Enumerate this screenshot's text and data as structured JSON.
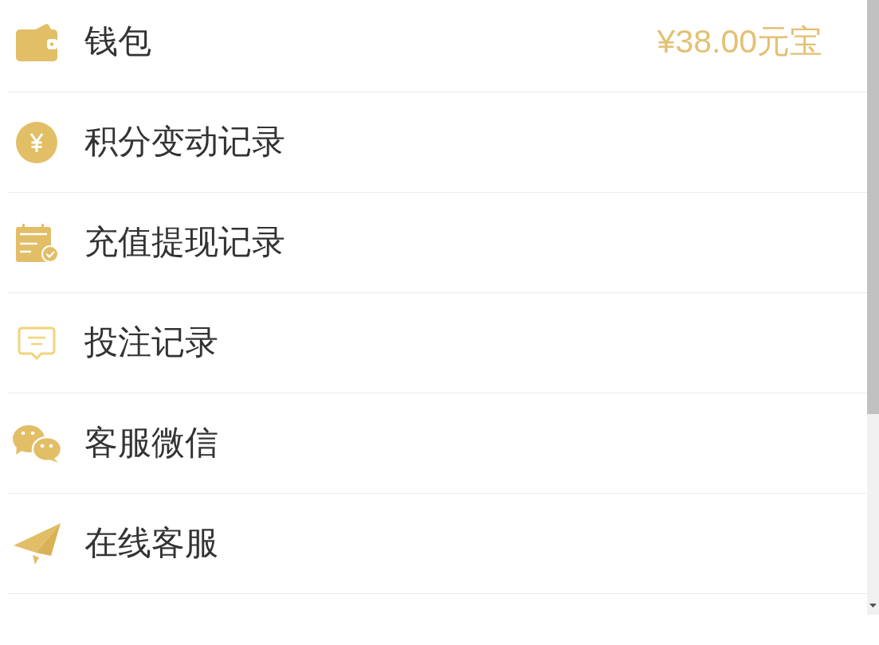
{
  "menu": [
    {
      "label": "钱包",
      "value": "¥38.00元宝"
    },
    {
      "label": "积分变动记录"
    },
    {
      "label": "充值提现记录"
    },
    {
      "label": "投注记录"
    },
    {
      "label": "客服微信"
    },
    {
      "label": "在线客服"
    }
  ]
}
